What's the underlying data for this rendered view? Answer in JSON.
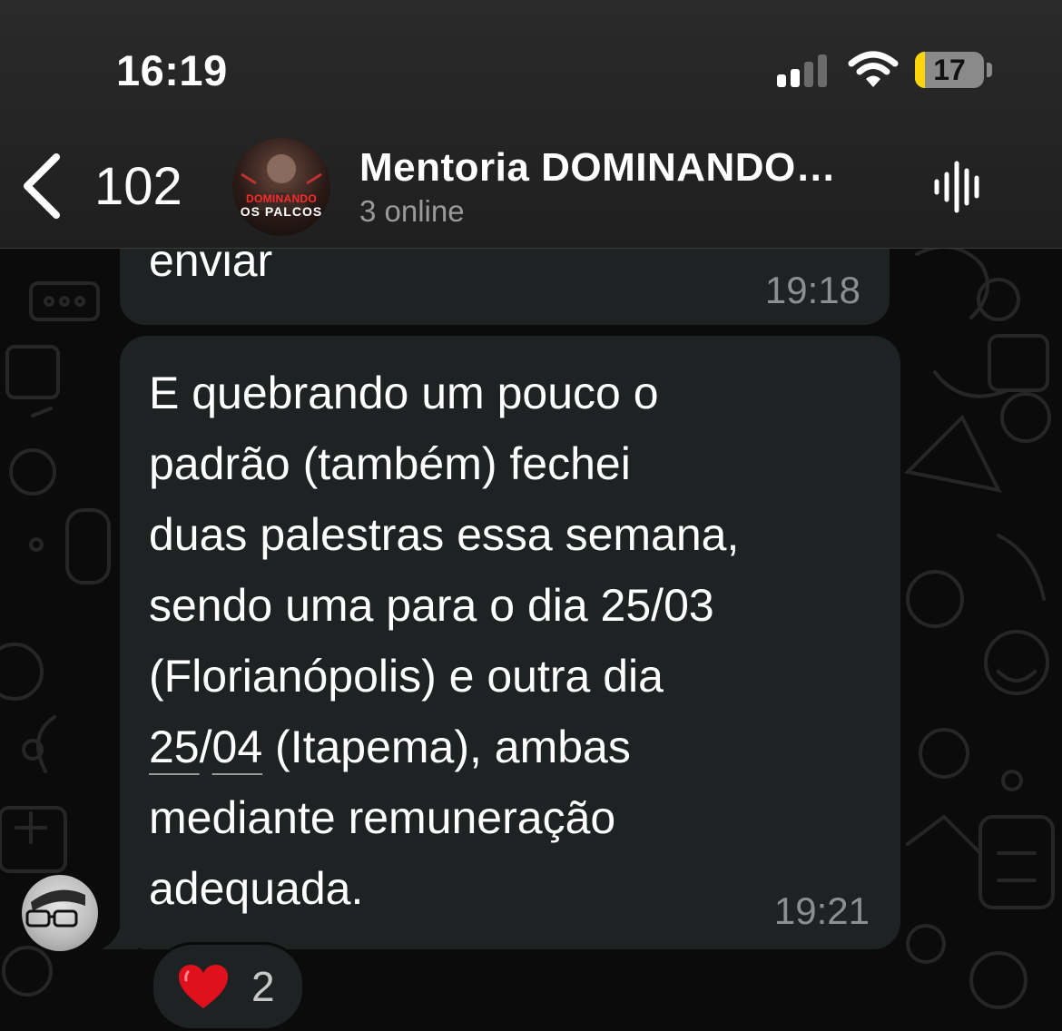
{
  "status_bar": {
    "time": "16:19",
    "battery": "17",
    "battery_color": "#ffd60a"
  },
  "header": {
    "back_count": "102",
    "title": "Mentoria DOMINANDO…",
    "subtitle": "3 online",
    "avatar_text_line1": "DOMINANDO",
    "avatar_text_line2": "OS PALCOS"
  },
  "messages": [
    {
      "text": "enviar",
      "time": "19:18"
    },
    {
      "line1": "E quebrando um pouco o",
      "line2": "padrão (também) fechei",
      "line3": "duas palestras essa semana,",
      "line4": "sendo uma para o dia 25/03",
      "line5": "(Florianópolis) e outra dia",
      "line6_link_a": "25",
      "line6_sep": "/",
      "line6_link_b": "04",
      "line6_rest": " (Itapema), ambas",
      "line7": "mediante remuneração",
      "line8": "adequada.",
      "time": "19:21",
      "reaction": {
        "icon": "heart-icon",
        "count": "2"
      }
    }
  ],
  "colors": {
    "bubble": "#1f2223",
    "background": "#0b0b0b",
    "timestamp": "#8b8f92",
    "reaction_heart": "#e0101d"
  }
}
